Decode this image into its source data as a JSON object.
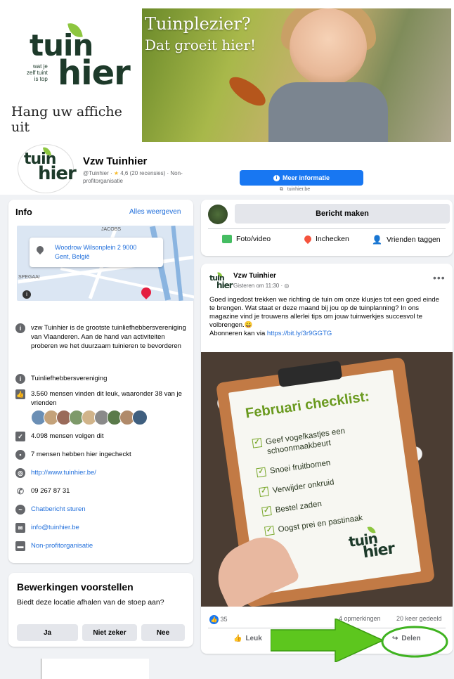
{
  "cover": {
    "logo_top": "tuin",
    "logo_bottom": "hier",
    "logo_tagline": [
      "wat je",
      "zelf tuint",
      "is top"
    ],
    "poster_cta": "Hang uw affiche uit",
    "photo_title_line1": "Tuinplezier?",
    "photo_title_line2": "Dat groeit hier!"
  },
  "profile": {
    "name": "Vzw Tuinhier",
    "handle_prefix": "@Tuinhier · ",
    "rating": "4,6 (20 recensies)",
    "category_suffix": " · Non-profitorganisatie",
    "button_label": "Meer informatie",
    "website_small": "tuinhier.be"
  },
  "info": {
    "title": "Info",
    "see_all": "Alles weergeven",
    "address_line1": "Woodrow Wilsonplein 2 9000",
    "address_line2": "Gent, België",
    "map_labels": [
      "JACOBS",
      "SPEGAAI"
    ],
    "rows": [
      {
        "icon": "info-icon",
        "text": "vzw Tuinhier is de grootste tuinliefhebbersvereniging van Vlaanderen. Aan de hand van activiteiten proberen we het duurzaam tuinieren te bevorderen"
      },
      {
        "icon": "info-icon",
        "text": "Tuinliefhebbersvereniging"
      },
      {
        "icon": "thumbs-up-icon",
        "text": "3.560 mensen vinden dit leuk, waaronder 38 van je vrienden"
      },
      {
        "icon": "follow-icon",
        "text": "4.098 mensen volgen dit"
      },
      {
        "icon": "location-icon",
        "text": "7 mensen hebben hier ingecheckt"
      },
      {
        "icon": "globe-icon",
        "text": "http://www.tuinhier.be/"
      },
      {
        "icon": "phone-icon",
        "text": "09 267 87 31"
      },
      {
        "icon": "messenger-icon",
        "text": "Chatbericht sturen"
      },
      {
        "icon": "mail-icon",
        "text": "info@tuinhier.be"
      },
      {
        "icon": "category-icon",
        "text": "Non-profitorganisatie"
      }
    ],
    "friend_colors": [
      "#6b8fb5",
      "#c4a27a",
      "#9a6b5a",
      "#7e9a6a",
      "#d1b48a",
      "#8a8a8a",
      "#5a7a4a",
      "#b08a6a",
      "#3f5f7f"
    ]
  },
  "suggest": {
    "title": "Bewerkingen voorstellen",
    "question": "Biedt deze locatie afhalen van de stoep aan?",
    "yes": "Ja",
    "unsure": "Niet zeker",
    "no": "Nee"
  },
  "compose": {
    "button": "Bericht maken",
    "photo_video": "Foto/video",
    "checkin": "Inchecken",
    "tag_friends": "Vrienden taggen"
  },
  "post": {
    "author": "Vzw Tuinhier",
    "time": "Gisteren om 11:30 · ",
    "body": "Goed ingedost trekken we richting de tuin om onze klusjes tot een goed einde te brengen. Wat staat er deze maand bij jou op de tuinplanning? In ons magazine vind je trouwens allerlei tips om jouw tuinwerkjes succesvol te volbrengen.😀",
    "subscribe_prefix": "Abonneren kan via ",
    "subscribe_link": "https://bit.ly/3r9GGTG",
    "checklist_title": "Februari checklist:",
    "checklist": [
      "Geef vogelkastjes een schoonmaakbeurt",
      "Snoei fruitbomen",
      "Verwijder onkruid",
      "Bestel zaden",
      "Oogst prei en pastinaak"
    ],
    "likes": "35",
    "comments": "4 opmerkingen",
    "shares": "20 keer gedeeld",
    "like_action": "Leuk",
    "share_action": "Delen"
  },
  "colors": {
    "fb_blue": "#1877f2",
    "link_blue": "#216fdb",
    "brand_green": "#8dc63f",
    "brand_dark": "#1d3a2a",
    "annotation_green": "#5dc61e"
  }
}
